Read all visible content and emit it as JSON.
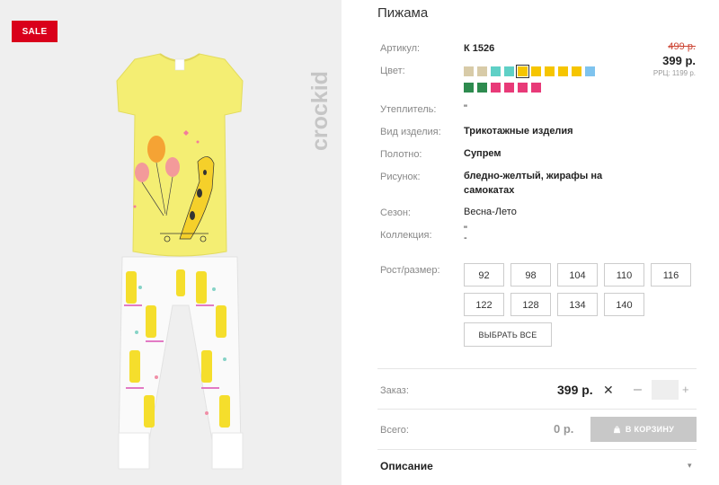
{
  "badge": {
    "sale": "SALE"
  },
  "brand": {
    "name": "crockid"
  },
  "product": {
    "title": "Пижама",
    "rows": [
      {
        "key": "article",
        "label": "Артикул:",
        "value": "К 1526"
      },
      {
        "key": "color",
        "label": "Цвет:"
      },
      {
        "key": "insulation",
        "label": "Утеплитель:",
        "value": "\""
      },
      {
        "key": "kind",
        "label": "Вид изделия:",
        "value": "Трикотажные изделия"
      },
      {
        "key": "fabric",
        "label": "Полотно:",
        "value": "Супрем"
      },
      {
        "key": "print",
        "label": "Рисунок:",
        "value": "бледно-желтый, жирафы на самокатах"
      },
      {
        "key": "season",
        "label": "Сезон:",
        "value": "Весна-Лето"
      },
      {
        "key": "collection",
        "label": "Коллекция:",
        "value": "\"\n-"
      }
    ],
    "swatches": [
      "#d8cba8",
      "#d8cba8",
      "#5fd0c6",
      "#5fd0c6",
      "#f6c500",
      "#f6c500",
      "#f6c500",
      "#f6c500",
      "#f6c500",
      "#7ec3ee",
      "#2e8b4f",
      "#2e8b4f",
      "#e83a78",
      "#e83a78",
      "#e83a78",
      "#e83a78"
    ],
    "selected_swatch": 4
  },
  "price": {
    "old": "499 р.",
    "current": "399 р.",
    "rrp": "РРЦ: 1199 р."
  },
  "sizes": {
    "label": "Рост/размер:",
    "options": [
      "92",
      "98",
      "104",
      "110",
      "116",
      "122",
      "128",
      "134",
      "140"
    ],
    "select_all": "ВЫБРАТЬ ВСЕ"
  },
  "order": {
    "label": "Заказ:",
    "price": "399 р.",
    "times": "✕",
    "minus": "–",
    "plus": "+",
    "qty": ""
  },
  "total": {
    "label": "Всего:",
    "value": "0 р.",
    "cart_button": "В КОРЗИНУ"
  },
  "description": {
    "label": "Описание",
    "chevron": "▾"
  }
}
